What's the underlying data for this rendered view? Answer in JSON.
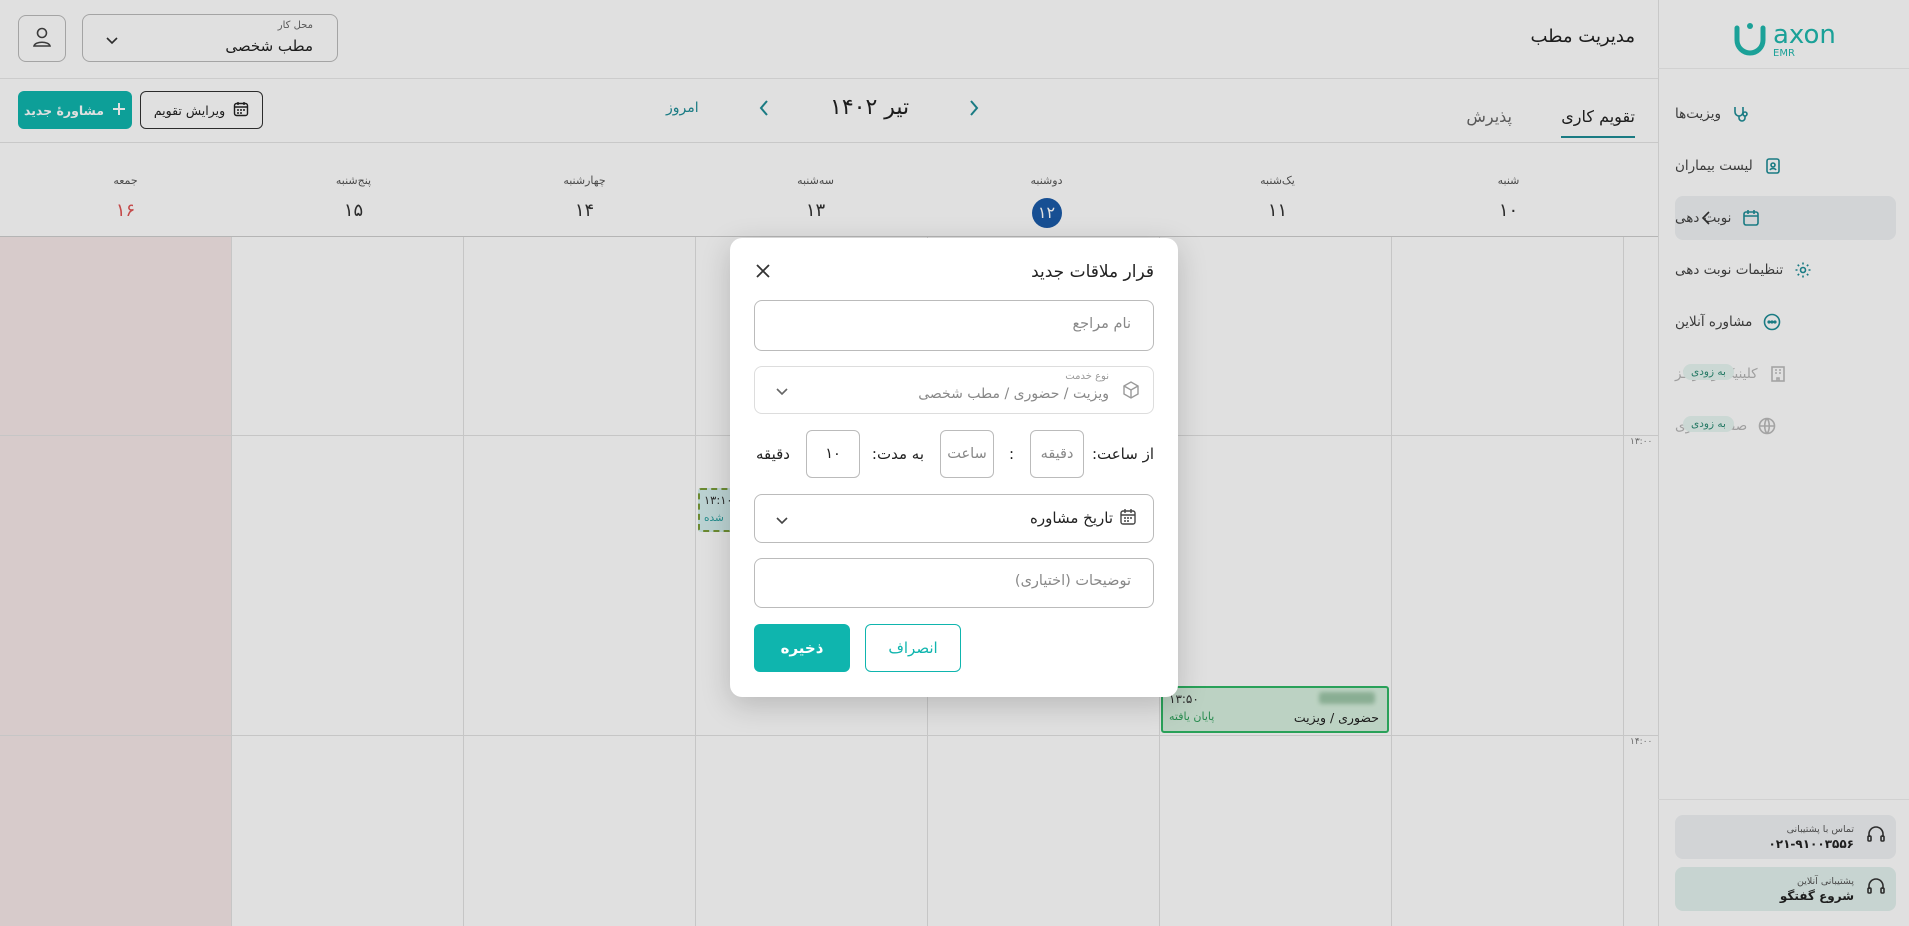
{
  "brand": {
    "name": "axon",
    "sub": "EMR",
    "color": "#1fb8ad"
  },
  "sidebar": {
    "items": [
      {
        "label": "ویزیت‌ها",
        "icon": "stethoscope-icon"
      },
      {
        "label": "لیست بیماران",
        "icon": "patient-list-icon"
      },
      {
        "label": "نوبت دهی",
        "icon": "calendar-icon"
      },
      {
        "label": "تنظیمات نوبت دهی",
        "icon": "gear-icon"
      },
      {
        "label": "مشاوره آنلاین",
        "icon": "chat-icon"
      },
      {
        "label": "کلینیک و مراکز",
        "icon": "building-icon",
        "badge": "به زودی"
      },
      {
        "label": "صفحه تجاری",
        "icon": "globe-icon",
        "badge": "به زودی"
      }
    ],
    "support": {
      "label": "تماس با پشتیبانی",
      "value": "۰۲۱-۹۱۰۰۳۵۵۶"
    },
    "chat": {
      "label": "پشتیبانی آنلاین",
      "value": "شروع گفتگو"
    }
  },
  "header": {
    "title": "مدیریت مطب",
    "workplace": {
      "label": "محل کار",
      "value": "مطب شخصی"
    }
  },
  "toolbar": {
    "tabs": [
      "تقویم کاری",
      "پذیرش"
    ],
    "month": "تیر ۱۴۰۲",
    "today": "امروز",
    "edit_label": "ویرایش تقویم",
    "new_label": "مشاورهٔ جدید"
  },
  "days": [
    {
      "name": "شنبه",
      "date": "۱۰"
    },
    {
      "name": "یک‌شنبه",
      "date": "۱۱"
    },
    {
      "name": "دوشنبه",
      "date": "۱۲"
    },
    {
      "name": "سه‌شنبه",
      "date": "۱۳"
    },
    {
      "name": "چهارشنبه",
      "date": "۱۴"
    },
    {
      "name": "پنج‌شنبه",
      "date": "۱۵"
    },
    {
      "name": "جمعه",
      "date": "۱۶"
    }
  ],
  "times": [
    "۱۳:۰۰",
    "۱۴:۰۰"
  ],
  "events": [
    {
      "time": "۱۳:۵۰",
      "type": "حضوری / ویزیت",
      "status": "پایان یافته"
    },
    {
      "time": "۱۳:۱۰",
      "status": "شده"
    }
  ],
  "modal": {
    "title": "قرار ملاقات جدید",
    "name_placeholder": "نام مراجع",
    "service_label": "نوع خدمت",
    "service_value": "ویزیت / حضوری / مطب شخصی",
    "from_label": "از ساعت:",
    "minute_ph": "دقیقه",
    "colon": ":",
    "hour_ph": "ساعت",
    "duration_label": "به مدت:",
    "duration_value": "۱۰",
    "duration_unit": "دقیقه",
    "date_label": "تاریخ مشاوره",
    "desc_placeholder": "توضیحات (اختیاری)",
    "save": "ذخیره",
    "cancel": "انصراف"
  }
}
